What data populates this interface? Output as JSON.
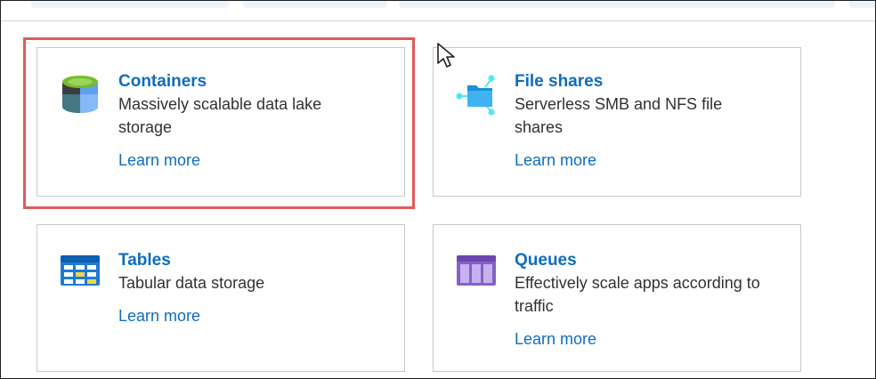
{
  "tiles": [
    {
      "title": "Containers",
      "description": "Massively scalable data lake storage",
      "link": "Learn more",
      "icon": "container-cylinder-icon"
    },
    {
      "title": "File shares",
      "description": "Serverless SMB and NFS file shares",
      "link": "Learn more",
      "icon": "folder-network-icon"
    },
    {
      "title": "Tables",
      "description": "Tabular data storage",
      "link": "Learn more",
      "icon": "table-grid-icon"
    },
    {
      "title": "Queues",
      "description": "Effectively scale apps according to traffic",
      "link": "Learn more",
      "icon": "queue-columns-icon"
    }
  ],
  "colors": {
    "link": "#0f6cbd",
    "highlight": "#e05a5a",
    "tile_border": "#c8c8c8"
  }
}
